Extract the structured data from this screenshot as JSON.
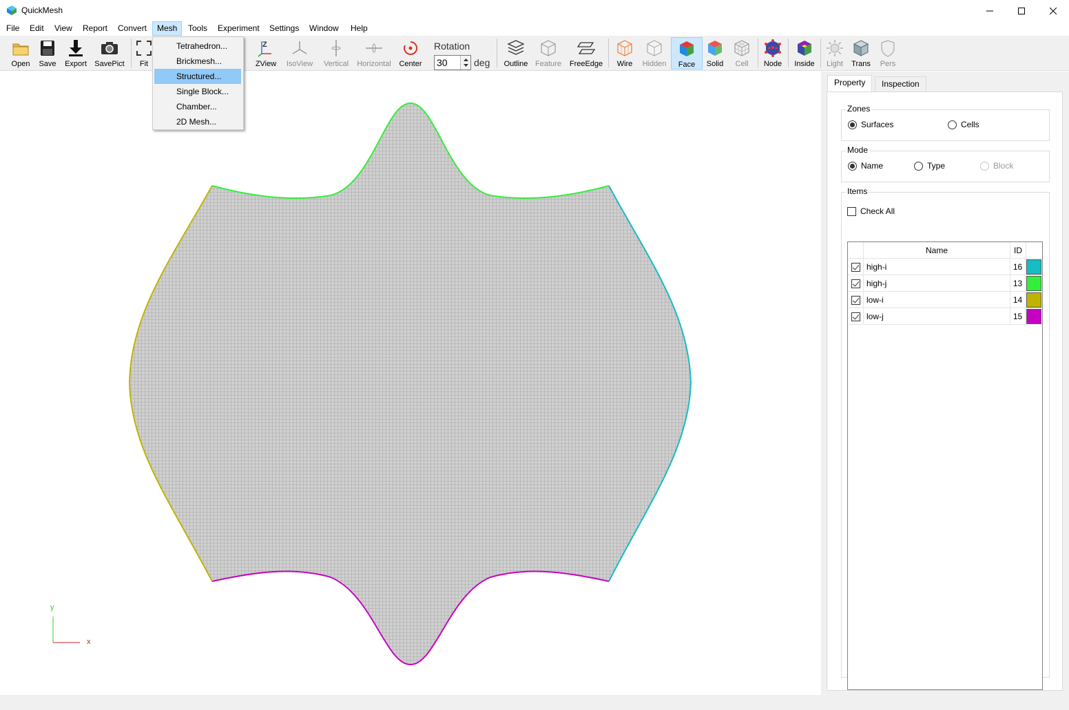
{
  "window": {
    "title": "QuickMesh",
    "minimize_icon": "minimize-icon",
    "maximize_icon": "maximize-icon",
    "close_icon": "close-icon"
  },
  "menubar": {
    "items": [
      "File",
      "Edit",
      "View",
      "Report",
      "Convert",
      "Mesh",
      "Tools",
      "Experiment",
      "Settings",
      "Window",
      "Help"
    ],
    "active": "Mesh"
  },
  "mesh_menu": {
    "items": [
      "Tetrahedron...",
      "Brickmesh...",
      "Structured...",
      "Single Block...",
      "Chamber...",
      "2D Mesh..."
    ],
    "highlighted": "Structured..."
  },
  "toolbar": {
    "open": "Open",
    "save": "Save",
    "export": "Export",
    "savepict": "SavePict",
    "fit": "Fit",
    "zview": "ZView",
    "isoview": "IsoView",
    "vertical": "Vertical",
    "horizontal": "Horizontal",
    "center": "Center",
    "rotation_label": "Rotation",
    "rotation_value": "30",
    "rotation_unit": "deg",
    "outline": "Outline",
    "feature": "Feature",
    "freeedge": "FreeEdge",
    "wire": "Wire",
    "hidden": "Hidden",
    "face": "Face",
    "solid": "Solid",
    "cell": "Cell",
    "node": "Node",
    "inside": "Inside",
    "light": "Light",
    "trans": "Trans",
    "pers": "Pers"
  },
  "viewport": {
    "axis_y": "y",
    "axis_x": "x",
    "mesh_fill": "#cfcfcf",
    "grid_color": "#8c8c8c"
  },
  "panel": {
    "tabs": [
      "Property",
      "Inspection"
    ],
    "selected_tab": "Property",
    "zones": {
      "title": "Zones",
      "options": [
        "Surfaces",
        "Cells"
      ],
      "selected": "Surfaces"
    },
    "mode": {
      "title": "Mode",
      "options": [
        "Name",
        "Type",
        "Block"
      ],
      "selected": "Name",
      "disabled": [
        "Block"
      ]
    },
    "items": {
      "title": "Items",
      "check_all": "Check All",
      "columns": [
        "Name",
        "ID"
      ],
      "rows": [
        {
          "name": "high-i",
          "id": "16",
          "color": "#17bcc4",
          "checked": true
        },
        {
          "name": "high-j",
          "id": "13",
          "color": "#33ee3a",
          "checked": true
        },
        {
          "name": "low-i",
          "id": "14",
          "color": "#bfb400",
          "checked": true
        },
        {
          "name": "low-j",
          "id": "15",
          "color": "#c800c4",
          "checked": true
        }
      ]
    }
  }
}
